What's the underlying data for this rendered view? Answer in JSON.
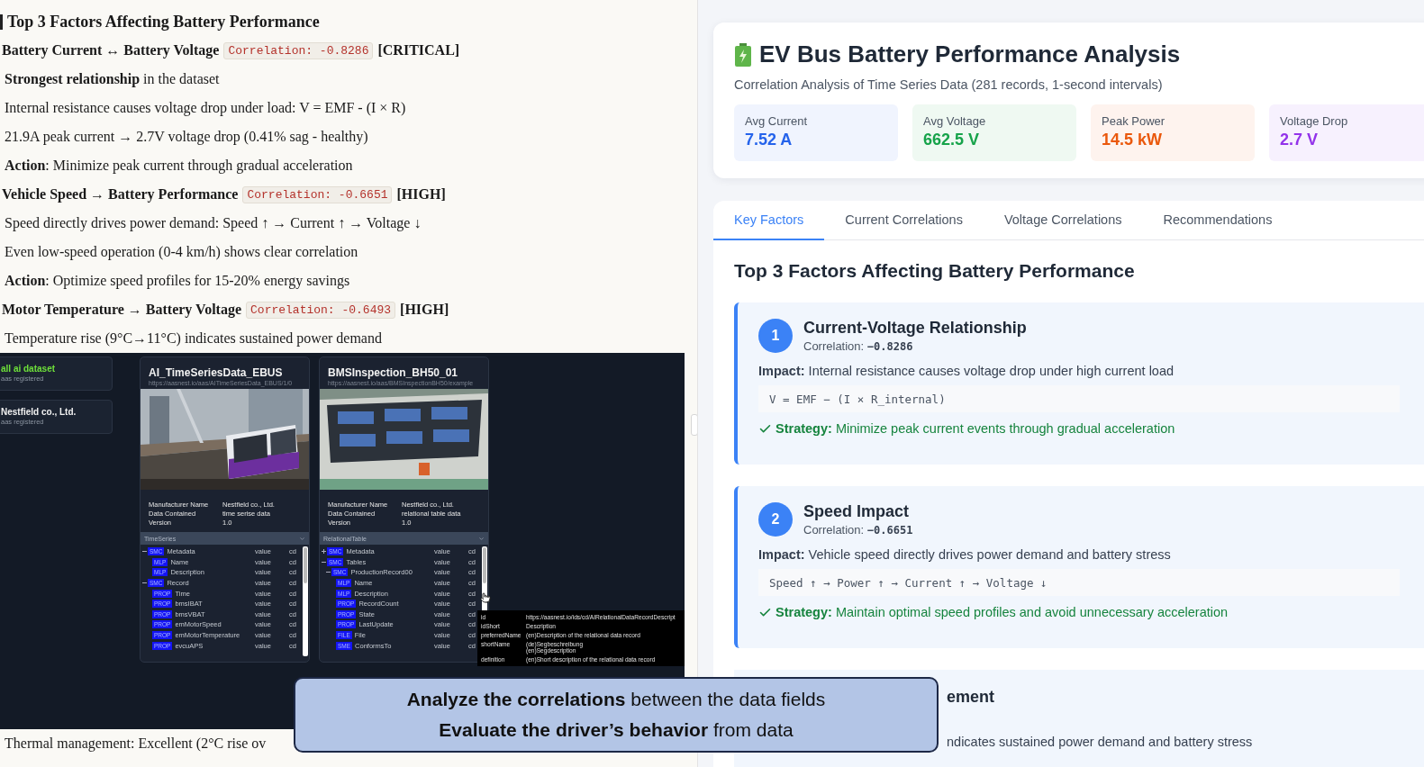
{
  "document": {
    "heading": "Top 3 Factors Affecting Battery Performance",
    "lines": [
      {
        "kind": "factor",
        "title": "Battery Current ↔ Battery Voltage",
        "code": "Correlation: -0.8286",
        "tag": "[CRITICAL]"
      },
      {
        "kind": "text",
        "text": "**Strongest relationship** in the dataset"
      },
      {
        "kind": "text",
        "text": "Internal resistance causes voltage drop under load: V = EMF - (I × R)"
      },
      {
        "kind": "text",
        "text": "21.9A peak current → 2.7V voltage drop (0.41% sag - healthy)"
      },
      {
        "kind": "text",
        "text": "**Action**: Minimize peak current through gradual acceleration"
      },
      {
        "kind": "factor",
        "title": "Vehicle Speed → Battery Performance",
        "code": "Correlation: -0.6651",
        "tag": "[HIGH]"
      },
      {
        "kind": "text",
        "text": "Speed directly drives power demand: Speed ↑ → Current ↑ → Voltage ↓"
      },
      {
        "kind": "text",
        "text": "Even low-speed operation (0-4 km/h) shows clear correlation"
      },
      {
        "kind": "text",
        "text": "**Action**: Optimize speed profiles for 15-20% energy savings"
      },
      {
        "kind": "factor",
        "title": "Motor Temperature → Battery Voltage",
        "code": "Correlation: -0.6493",
        "tag": "[HIGH]"
      },
      {
        "kind": "text",
        "text": "Temperature rise (9°C→11°C) indicates sustained power demand"
      }
    ],
    "screenshot": {
      "sidebar": [
        {
          "name": "all ai dataset",
          "count": "aas registered",
          "selected": true
        },
        {
          "name": "Nestfield co., Ltd.",
          "count": "aas registered",
          "selected": false
        }
      ],
      "cards": [
        {
          "title": "AI_TimeSeriesData_EBUS",
          "url": "https://aasnest.io/aas/AITimeSeriesData_EBUS/1/0",
          "properties": [
            {
              "label": "Manufacturer Name",
              "value": "Nestfield co., Ltd."
            },
            {
              "label": "Data Contained",
              "value": "time serise data"
            },
            {
              "label": "Version",
              "value": "1.0"
            }
          ],
          "section": "TimeSeries",
          "tree": [
            {
              "tag": "SMC",
              "name": "Metadata",
              "value": "value",
              "cd": "cd",
              "expanded": true,
              "children": [
                {
                  "tag": "MLP",
                  "name": "Name",
                  "value": "value",
                  "cd": "cd"
                },
                {
                  "tag": "MLP",
                  "name": "Description",
                  "value": "value",
                  "cd": "cd"
                }
              ]
            },
            {
              "tag": "SMC",
              "name": "Record",
              "value": "value",
              "cd": "cd",
              "expanded": true,
              "children": [
                {
                  "tag": "PROP",
                  "name": "Time",
                  "value": "value",
                  "cd": "cd"
                },
                {
                  "tag": "PROP",
                  "name": "bmsIBAT",
                  "value": "value",
                  "cd": "cd"
                },
                {
                  "tag": "PROP",
                  "name": "bmsVBAT",
                  "value": "value",
                  "cd": "cd"
                },
                {
                  "tag": "PROP",
                  "name": "emMotorSpeed",
                  "value": "value",
                  "cd": "cd"
                },
                {
                  "tag": "PROP",
                  "name": "emMotorTemperature",
                  "value": "value",
                  "cd": "cd"
                },
                {
                  "tag": "PROP",
                  "name": "evcuAPS",
                  "value": "value",
                  "cd": "cd"
                }
              ]
            }
          ]
        },
        {
          "title": "BMSInspection_BH50_01",
          "url": "https://aasnest.io/aas/BMSInspectionBH50/example",
          "properties": [
            {
              "label": "Manufacturer Name",
              "value": "Nestfield co., Ltd."
            },
            {
              "label": "Data Contained",
              "value": "relational table data"
            },
            {
              "label": "Version",
              "value": "1.0"
            }
          ],
          "section": "RelationalTable",
          "tree": [
            {
              "tag": "SMC",
              "name": "Metadata",
              "value": "value",
              "cd": "cd",
              "expanded": false
            },
            {
              "tag": "SMC",
              "name": "Tables",
              "value": "value",
              "cd": "cd",
              "expanded": true,
              "children": [
                {
                  "tag": "SMC",
                  "name": "ProductionRecord00",
                  "value": "value",
                  "cd": "cd",
                  "expanded": true,
                  "children": [
                    {
                      "tag": "MLP",
                      "name": "Name",
                      "value": "value",
                      "cd": "cd"
                    },
                    {
                      "tag": "MLP",
                      "name": "Description",
                      "value": "value",
                      "cd": "cd"
                    },
                    {
                      "tag": "PROP",
                      "name": "RecordCount",
                      "value": "value",
                      "cd": "cd"
                    },
                    {
                      "tag": "PROP",
                      "name": "State",
                      "value": "value",
                      "cd": "cd"
                    },
                    {
                      "tag": "PROP",
                      "name": "LastUpdate",
                      "value": "value",
                      "cd": "cd"
                    },
                    {
                      "tag": "FILE",
                      "name": "File",
                      "value": "value",
                      "cd": "cd"
                    },
                    {
                      "tag": "SME",
                      "name": "ConformsTo",
                      "value": "value",
                      "cd": "cd"
                    }
                  ]
                }
              ]
            }
          ]
        }
      ],
      "tooltip": [
        {
          "key": "id",
          "values": [
            "https://aasnest.io/ids/cd/AIRelationalDataRecordDescript"
          ]
        },
        {
          "key": "idShort",
          "values": [
            "Description"
          ]
        },
        {
          "key": "preferredName",
          "values": [
            "(en)Description of the relational data record"
          ]
        },
        {
          "key": "shortName",
          "values": [
            "(de)Segbeschreibung",
            "(en)Segdescription"
          ]
        },
        {
          "key": "definition",
          "values": [
            "(en)Short description of the relational data record"
          ]
        }
      ]
    },
    "footer_line": "Thermal management: Excellent (2°C rise ov"
  },
  "dashboard": {
    "title": "EV Bus Battery Performance Analysis",
    "subtitle": "Correlation Analysis of Time Series Data (281 records, 1-second intervals)",
    "stats": [
      {
        "label": "Avg Current",
        "value": "7.52 A",
        "color": "#2563eb"
      },
      {
        "label": "Avg Voltage",
        "value": "662.5 V",
        "color": "#16a34a"
      },
      {
        "label": "Peak Power",
        "value": "14.5 kW",
        "color": "#ea580c"
      },
      {
        "label": "Voltage Drop",
        "value": "2.7 V",
        "color": "#9333ea"
      }
    ],
    "tabs": [
      {
        "label": "Key Factors",
        "selected": true
      },
      {
        "label": "Current Correlations",
        "selected": false
      },
      {
        "label": "Voltage Correlations",
        "selected": false
      },
      {
        "label": "Recommendations",
        "selected": false
      }
    ],
    "section_title": "Top 3 Factors Affecting Battery Performance",
    "factors": [
      {
        "number": "1",
        "title": "Current-Voltage Relationship",
        "correlation_label": "Correlation:",
        "correlation": "−0.8286",
        "impact": "**Impact:** Internal resistance causes voltage drop under high current load",
        "formula": "V = EMF − (I × R_internal)",
        "strategy": "**Strategy:** Minimize peak current events through gradual acceleration"
      },
      {
        "number": "2",
        "title": "Speed Impact",
        "correlation_label": "Correlation:",
        "correlation": "−0.6651",
        "impact": "**Impact:** Vehicle speed directly drives power demand and battery stress",
        "formula": "Speed ↑ → Power ↑ → Current ↑ → Voltage ↓",
        "strategy": "**Strategy:** Maintain optimal speed profiles and avoid unnecessary acceleration"
      }
    ],
    "partial_factor": {
      "title": "ement",
      "impact": "ndicates sustained power demand and battery stress"
    }
  },
  "caption": {
    "lines": [
      "**Analyze the correlations** between the data fields",
      "**Evaluate the driver’s behavior** from data"
    ]
  }
}
